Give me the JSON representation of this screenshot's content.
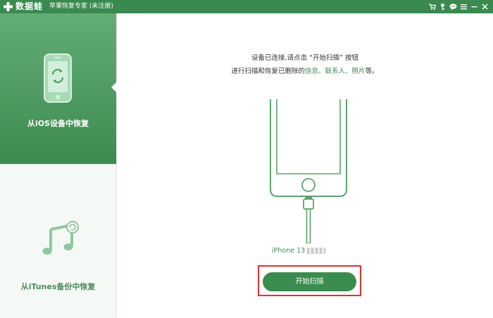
{
  "titlebar": {
    "brand": "数据蛙",
    "app_title": "苹果恢复专家 (未注册)",
    "icons": [
      "cart-icon",
      "key-icon",
      "chat-icon",
      "menu-icon",
      "minimize-icon",
      "close-icon"
    ]
  },
  "sidebar": {
    "items": [
      {
        "label": "从iOS设备中恢复",
        "icon": "phone-restore-icon",
        "active": true
      },
      {
        "label": "从iTunes备份中恢复",
        "icon": "music-note-icon",
        "active": false
      }
    ]
  },
  "main": {
    "instruction_line1": "设备已连接,请点击 “开始扫描” 按钮",
    "instruction_line2_prefix": "进行扫描和恢复已删除的",
    "instruction_hl1": "信息",
    "instruction_sep1": "、",
    "instruction_hl2": "联系人",
    "instruction_sep2": "、",
    "instruction_hl3": "照片",
    "instruction_line2_suffix": "等。",
    "device_name": "iPhone 13",
    "start_button": "开始扫描"
  },
  "colors": {
    "accent_green": "#3e8b52",
    "highlight_red": "#e0322f",
    "titlebar": "#3a8a50"
  }
}
